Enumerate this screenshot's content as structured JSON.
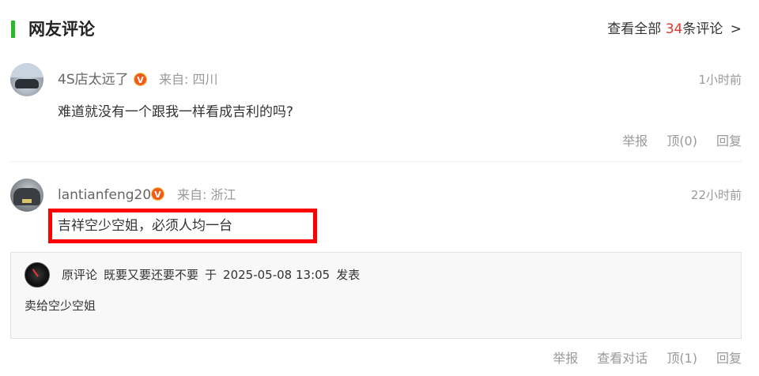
{
  "header": {
    "title": "网友评论",
    "view_all_prefix": "查看全部",
    "count": "34",
    "view_all_suffix": "条评论",
    "chevron": ">",
    "accent_color": "#2bb82b",
    "count_color": "#e5362a"
  },
  "comments": [
    {
      "username": "4S店太远了",
      "badge": "V",
      "from": "来自: 四川",
      "time": "1小时前",
      "text": "难道就没有一个跟我一样看成吉利的吗?",
      "actions": {
        "report": "举报",
        "like": "顶(0)",
        "reply": "回复"
      }
    },
    {
      "username": "lantianfeng201",
      "badge": "V",
      "from": "来自: 浙江",
      "time": "22小时前",
      "text": "吉祥空少空姐，必须人均一台",
      "quote": {
        "label": "原评论",
        "author": "既要又要还要不要",
        "date_prefix": "于",
        "date": "2025-05-08 13:05",
        "date_suffix": "发表",
        "text": "卖给空少空姐"
      },
      "actions": {
        "report": "举报",
        "view_conversation": "查看对话",
        "like": "顶(1)",
        "reply": "回复"
      }
    }
  ],
  "highlight_color": "#ff0000"
}
